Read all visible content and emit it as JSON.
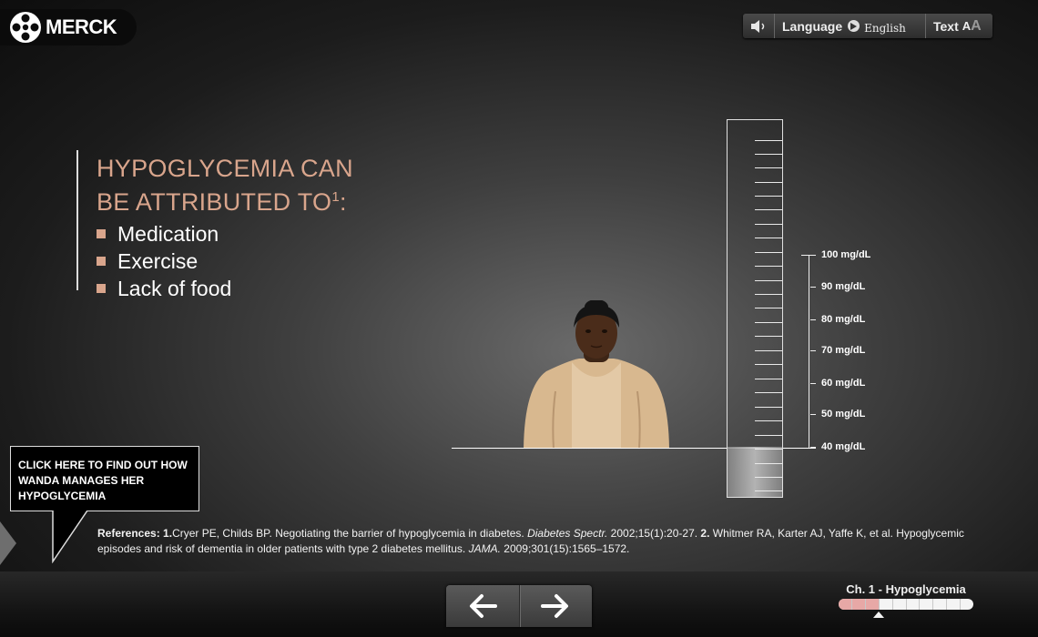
{
  "logo": {
    "text": "MERCK"
  },
  "toolbar": {
    "sound_icon": "speaker-icon",
    "language_label": "Language",
    "language_value": "English",
    "text_label": "Text",
    "text_small": "A",
    "text_large": "A"
  },
  "headline": {
    "title_line1": "HYPOGLYCEMIA CAN",
    "title_line2": "BE ATTRIBUTED TO",
    "title_sup": "1",
    "title_colon": ":",
    "items": [
      "Medication",
      "Exercise",
      "Lack of food"
    ]
  },
  "scale": {
    "labels": [
      "100 mg/dL",
      "90 mg/dL",
      "80 mg/dL",
      "70 mg/dL",
      "60 mg/dL",
      "50 mg/dL",
      "40 mg/dL"
    ]
  },
  "callout": {
    "line1": "CLICK HERE TO FIND OUT HOW",
    "line2": "WANDA MANAGES HER",
    "line3": "HYPOGLYCEMIA"
  },
  "references": {
    "label": "References:",
    "r1_num": "1.",
    "r1_text": "Cryer PE, Childs BP. Negotiating the barrier of hypoglycemia in diabetes.",
    "r1_journal": "Diabetes Spectr.",
    "r1_cite": "2002;15(1):20-27.",
    "r2_num": "2.",
    "r2_text": "Whitmer RA, Karter AJ, Yaffe K, et al. Hypoglycemic episodes and risk of dementia in older patients with type 2 diabetes mellitus.",
    "r2_journal": "JAMA.",
    "r2_cite": "2009;301(15):1565–1572."
  },
  "navigation": {
    "back_icon": "arrow-left-icon",
    "forward_icon": "arrow-right-icon"
  },
  "chapter": {
    "label": "Ch. 1 - Hypoglycemia",
    "segments_total": 10,
    "segments_done": 3
  },
  "colors": {
    "accent": "#d9a58c",
    "progress_done": "#e7a8a6"
  }
}
